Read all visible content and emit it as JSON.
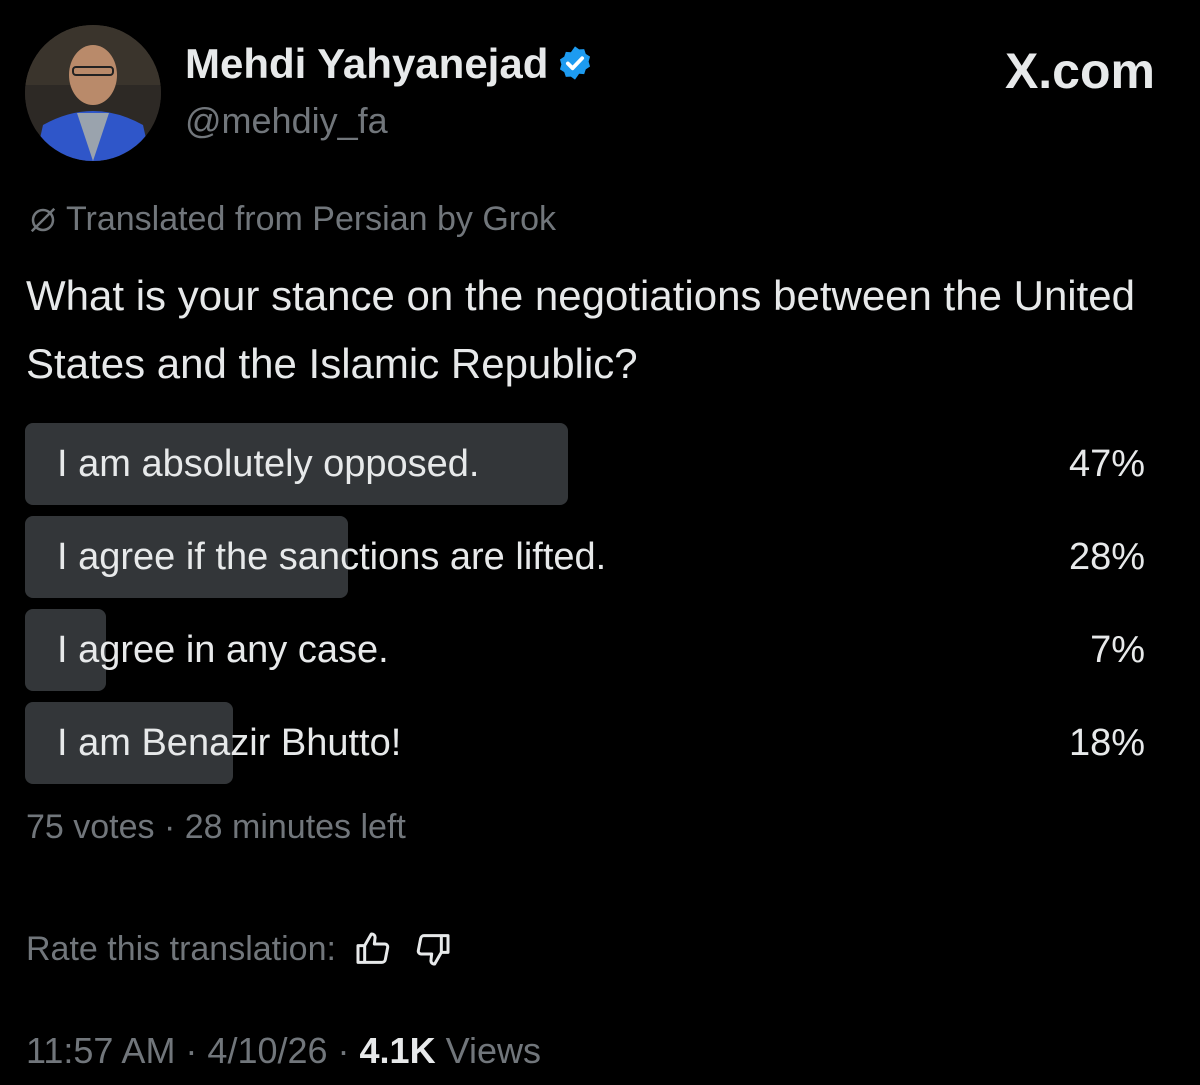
{
  "author": {
    "name": "Mehdi Yahyanejad",
    "handle": "@mehdiy_fa",
    "verified_color": "#1d9bf0"
  },
  "brand": "X.com",
  "translation_note": "Translated from Persian by Grok",
  "post_text": "What is your stance on the negotiations between the United States and the Islamic Republic?",
  "poll": {
    "options": [
      {
        "label": "I am absolutely opposed.",
        "percent_label": "47%",
        "percent": 47
      },
      {
        "label": "I agree if the sanctions are lifted.",
        "percent_label": "28%",
        "percent": 28
      },
      {
        "label": "I agree in any case.",
        "percent_label": "7%",
        "percent": 7
      },
      {
        "label": "I am Benazir Bhutto!",
        "percent_label": "18%",
        "percent": 18
      }
    ],
    "meta": "75 votes · 28 minutes left"
  },
  "rate_translation": {
    "label": "Rate this translation:",
    "icons": [
      "thumbs-up-icon",
      "thumbs-down-icon"
    ]
  },
  "footer": {
    "time_date": "11:57 AM · 4/10/26 · ",
    "views_count": "4.1K",
    "views_label": " Views"
  },
  "colors": {
    "background": "#000000",
    "text": "#e7e9ea",
    "muted": "#71767b",
    "poll_bar": "#333639"
  }
}
